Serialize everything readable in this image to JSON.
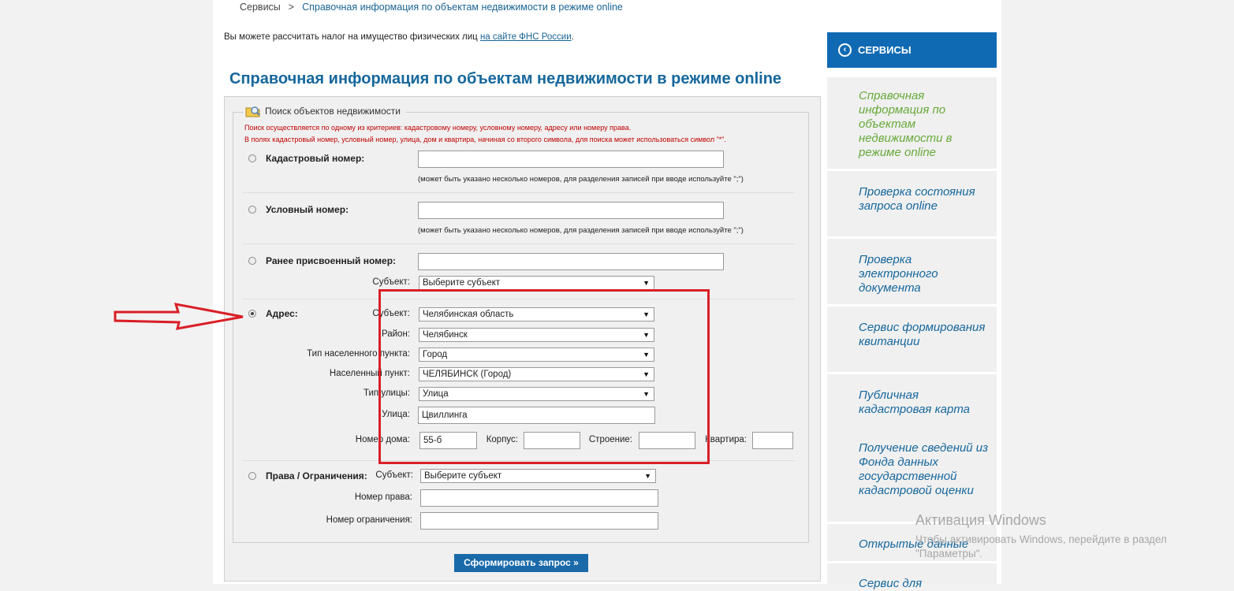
{
  "breadcrumb": {
    "root": "Сервисы",
    "separator": ">",
    "current": "Справочная информация по объектам недвижимости в режиме online"
  },
  "intro": {
    "text": "Вы можете рассчитать налог на имущество физических лиц",
    "link": "на сайте ФНС России",
    "suffix": "."
  },
  "page_title": "Справочная информация по объектам недвижимости в режиме online",
  "form": {
    "legend": "Поиск объектов недвижимости",
    "note_1": "Поиск осуществляется по одному из критериев: кадастровому номеру, условному номеру, адресу или номеру права.",
    "note_2": "В полях кадастровый номер, условный номер, улица, дом и квартира, начиная со второго символа, для поиска может использоваться символ \"*\".",
    "cadastral": {
      "label": "Кадастровый номер:",
      "value": "",
      "hint": "(может быть указано несколько номеров, для разделения записей при вводе используйте \";\")"
    },
    "conditional": {
      "label": "Условный номер:",
      "value": "",
      "hint": "(может быть указано несколько номеров, для разделения записей при вводе используйте \";\")"
    },
    "previous": {
      "label": "Ранее присвоенный номер:",
      "value": "",
      "subject_label": "Субъект:",
      "subject_value": "Выберите субъект"
    },
    "address": {
      "label": "Адрес:",
      "selected": true,
      "subject_label": "Субъект:",
      "subject_value": "Челябинская область",
      "district_label": "Район:",
      "district_value": "Челябинск",
      "settlement_type_label": "Тип населенного пункта:",
      "settlement_type_value": "Город",
      "settlement_label": "Населенный пункт:",
      "settlement_value": "ЧЕЛЯБИНСК (Город)",
      "street_type_label": "Тип улицы:",
      "street_type_value": "Улица",
      "street_label": "Улица:",
      "street_value": "Цвиллинга",
      "house_label": "Номер дома:",
      "house_value": "55-б",
      "building_label": "Корпус:",
      "building_value": "",
      "structure_label": "Строение:",
      "structure_value": "",
      "apartment_label": "Квартира:",
      "apartment_value": ""
    },
    "rights": {
      "label": "Права / Ограничения:",
      "subject_label": "Субъект:",
      "subject_value": "Выберите субъект",
      "right_number_label": "Номер права:",
      "right_number_value": "",
      "restriction_label": "Номер ограничения:",
      "restriction_value": ""
    },
    "submit_label": "Сформировать запрос »"
  },
  "sidebar": {
    "header": "СЕРВИСЫ",
    "items": [
      {
        "label": "Справочная информация по объектам недвижимости в режиме online",
        "active": true
      },
      {
        "label": "Проверка состояния запроса online"
      },
      {
        "label": "Проверка электронного документа"
      },
      {
        "label": "Сервис формирования квитанции"
      },
      {
        "label": "Публичная кадастровая карта"
      },
      {
        "label": "Получение сведений из Фонда данных государственной кадастровой оценки"
      },
      {
        "label": "Открытые данные"
      },
      {
        "label": "Сервис для"
      }
    ]
  },
  "watermark": {
    "title": "Активация Windows",
    "text": "Чтобы активировать Windows, перейдите в раздел \"Параметры\"."
  },
  "colors": {
    "accent_blue": "#16679c",
    "button_blue": "#1a6aaa",
    "sidebar_active": "#67a93a",
    "annotation_red": "#d91f26",
    "note_red": "#c00000"
  },
  "icons": {
    "legend": "search-folder-icon",
    "sidebar_back": "chevron-left-circle-icon",
    "select_arrow": "triangle-down-icon"
  }
}
